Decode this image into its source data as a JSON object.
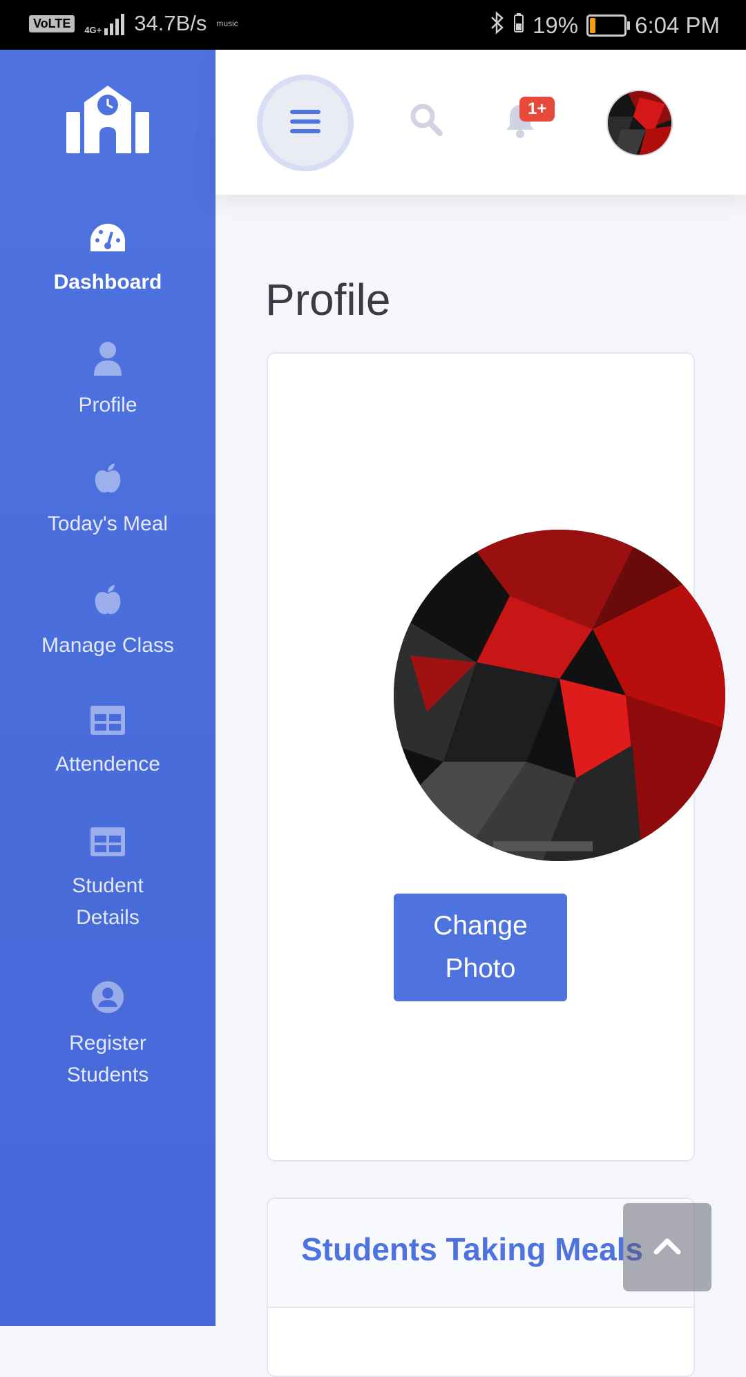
{
  "status_bar": {
    "volte": "VoLTE",
    "network": "4G+",
    "speed": "34.7B/s",
    "music": "music",
    "battery": "19%",
    "battery_level": 0.19,
    "time": "6:04 PM"
  },
  "sidebar": {
    "items": [
      {
        "label": "Dashboard",
        "icon": "tachometer-icon",
        "active": true
      },
      {
        "label": "Profile",
        "icon": "user-icon"
      },
      {
        "label": "Today's Meal",
        "icon": "apple-icon"
      },
      {
        "label": "Manage Class",
        "icon": "apple-icon"
      },
      {
        "label": "Attendence",
        "icon": "table-icon"
      },
      {
        "label": "Student Details",
        "icon": "table-icon"
      },
      {
        "label": "Register Students",
        "icon": "user-circle-icon"
      }
    ]
  },
  "topbar": {
    "notification_count": "1+"
  },
  "main": {
    "page_title": "Profile",
    "change_photo_label": "Change Photo",
    "students_meals_title": "Students Taking Meals"
  },
  "colors": {
    "primary": "#4e73df",
    "danger": "#e74a3b"
  }
}
